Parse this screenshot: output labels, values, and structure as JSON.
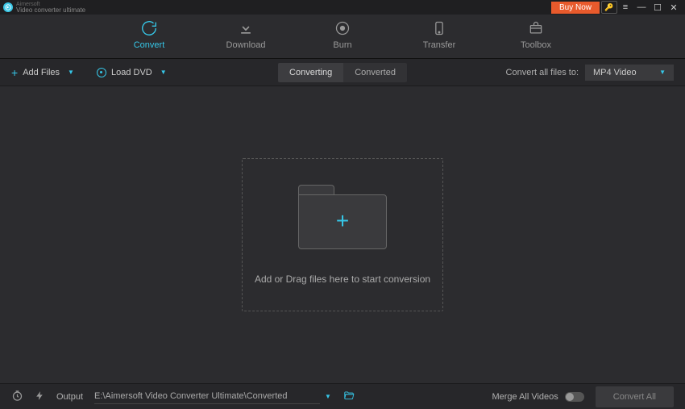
{
  "app": {
    "brand_small": "Aimersoft",
    "brand": "Video converter ultimate"
  },
  "titlebar": {
    "buy_now": "Buy Now"
  },
  "nav": {
    "items": [
      {
        "label": "Convert",
        "icon": "convert"
      },
      {
        "label": "Download",
        "icon": "download"
      },
      {
        "label": "Burn",
        "icon": "burn"
      },
      {
        "label": "Transfer",
        "icon": "transfer"
      },
      {
        "label": "Toolbox",
        "icon": "toolbox"
      }
    ]
  },
  "toolbar": {
    "add_files": "Add Files",
    "load_dvd": "Load DVD",
    "seg_converting": "Converting",
    "seg_converted": "Converted",
    "convert_label": "Convert all files to:",
    "format": "MP4 Video"
  },
  "dropzone": {
    "text": "Add or Drag files here to start conversion"
  },
  "footer": {
    "output_label": "Output",
    "output_path": "E:\\Aimersoft Video Converter Ultimate\\Converted",
    "merge_label": "Merge All Videos",
    "convert_all": "Convert All"
  }
}
